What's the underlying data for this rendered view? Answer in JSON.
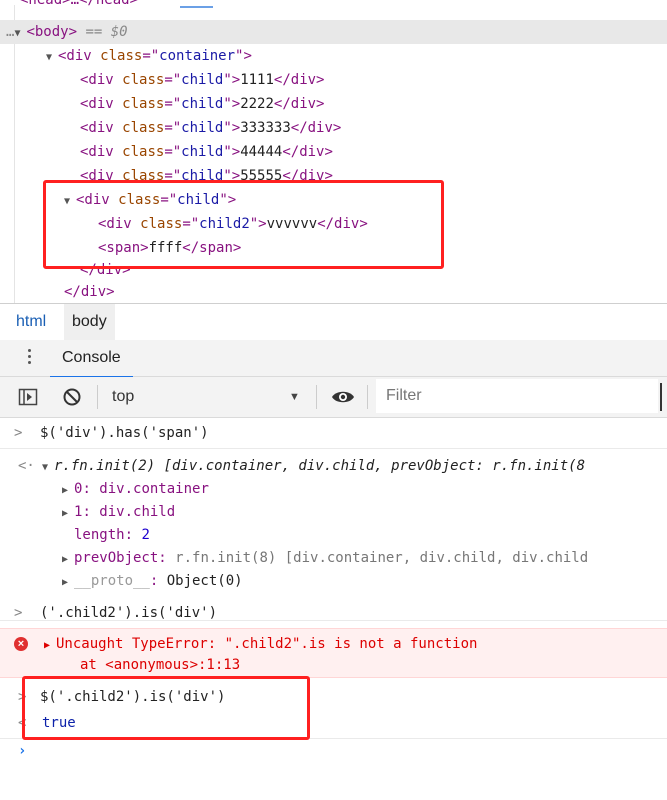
{
  "elements": {
    "head_line": "<head>…</head>",
    "body_open_tag": "<body>",
    "body_marker": "== $0",
    "body_prefix": "…",
    "container_tag_open": "<div",
    "attr_class": "class",
    "container_class": "container",
    "child_class": "child",
    "child2_class": "child2",
    "children": [
      {
        "text": "1111"
      },
      {
        "text": "2222"
      },
      {
        "text": "333333"
      },
      {
        "text": "44444"
      },
      {
        "text": "55555"
      }
    ],
    "child2_text": "vvvvvv",
    "span_open": "<span>",
    "span_text": "ffff",
    "span_close": "</span>",
    "div_close": "</div>"
  },
  "breadcrumb": {
    "items": [
      "html",
      "body"
    ]
  },
  "console_header": {
    "tab_label": "Console"
  },
  "toolbar": {
    "context": "top",
    "filter_placeholder": "Filter"
  },
  "console": {
    "cmd1": "$('div').has('span')",
    "result_head": "r.fn.init(2) [div.container, div.child, prevObject: r.fn.init(8",
    "result_items": [
      {
        "key": "0",
        "value": "div.container"
      },
      {
        "key": "1",
        "value": "div.child"
      }
    ],
    "length_key": "length",
    "length_value": "2",
    "prev_key": "prevObject",
    "prev_value": "r.fn.init(8) [div.container, div.child, div.child",
    "proto_key": "__proto__",
    "proto_value": "Object(0)",
    "cmd2": "('.child2').is('div')",
    "error_line1": "Uncaught TypeError: \".child2\".is is not a function",
    "error_line2": "at <anonymous>:1:13",
    "cmd3": "$('.child2').is('div')",
    "result3": "true"
  },
  "colors": {
    "highlight_box": "#ff2020",
    "tag": "#881280",
    "attr_value": "#1a1aa6",
    "error": "#d00000"
  }
}
